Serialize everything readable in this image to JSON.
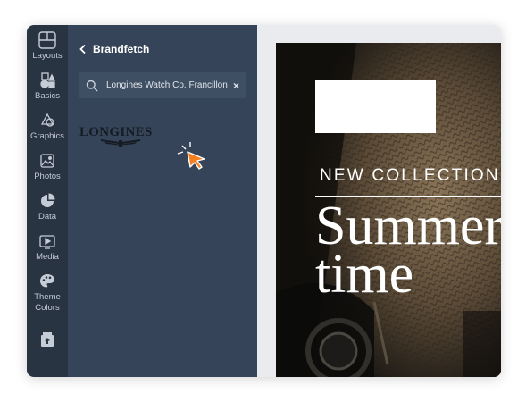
{
  "rail": {
    "items": [
      {
        "label": "Layouts",
        "icon": "layouts-icon"
      },
      {
        "label": "Basics",
        "icon": "basics-icon"
      },
      {
        "label": "Graphics",
        "icon": "graphics-icon"
      },
      {
        "label": "Photos",
        "icon": "photos-icon"
      },
      {
        "label": "Data",
        "icon": "data-icon"
      },
      {
        "label": "Media",
        "icon": "media-icon"
      },
      {
        "label": "Theme\nColors",
        "icon": "palette-icon"
      },
      {
        "label": "",
        "icon": "upload-icon"
      }
    ]
  },
  "panel": {
    "back_label": "Brandfetch",
    "search": {
      "value": "Longines Watch Co. Francillon",
      "clear": "×"
    },
    "results": [
      {
        "logo_text": "LONGINES"
      }
    ]
  },
  "design": {
    "eyebrow": "NEW COLLECTION",
    "headline_line1": "Summer",
    "headline_line2": "time"
  },
  "colors": {
    "rail_bg": "#293442",
    "panel_bg": "#354458",
    "cursor": "#f47f20",
    "stage_bg": "#e9ebee"
  }
}
